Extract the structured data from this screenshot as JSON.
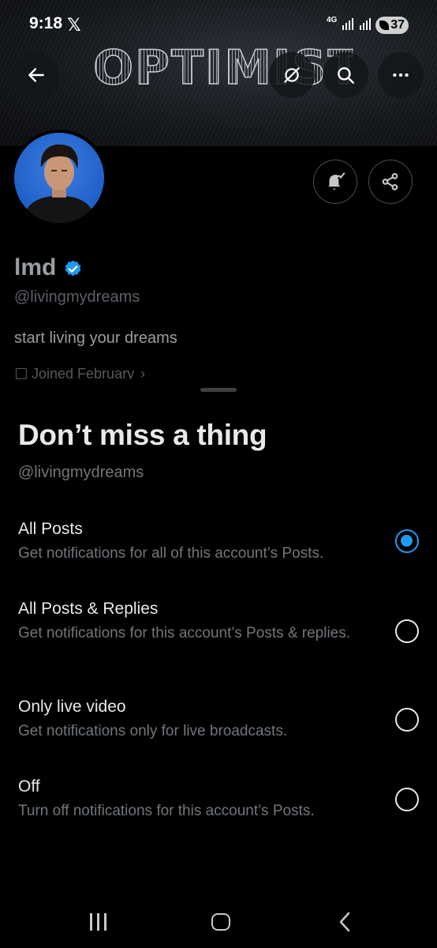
{
  "status_bar": {
    "time": "9:18",
    "app_icon": "x-logo-icon",
    "network": "4G",
    "battery": "37"
  },
  "header": {
    "banner_text": "OPTIMIST",
    "back_icon": "arrow-left-icon",
    "grok_icon": "grok-icon",
    "search_icon": "search-icon",
    "more_icon": "more-horizontal-icon"
  },
  "profile": {
    "name": "lmd",
    "handle": "@livingmydreams",
    "bio": "start living your dreams",
    "joined": "Joined February",
    "verified_color": "#1d9bf0",
    "notify_icon": "bell-check-icon",
    "share_icon": "share-icon"
  },
  "sheet": {
    "title": "Don’t miss a thing",
    "handle": "@livingmydreams",
    "options": [
      {
        "label": "All Posts",
        "description": "Get notifications for all of this account’s Posts.",
        "selected": true
      },
      {
        "label": "All Posts & Replies",
        "description": "Get notifications for this account’s Posts & replies.",
        "selected": false
      },
      {
        "label": "Only live video",
        "description": "Get notifications only for live broadcasts.",
        "selected": false
      },
      {
        "label": "Off",
        "description": "Turn off notifications for this account’s Posts.",
        "selected": false
      }
    ],
    "accent_color": "#1d9bf0"
  },
  "nav": {
    "recents_icon": "recent-apps-icon",
    "home_icon": "home-icon",
    "back_icon": "back-icon"
  }
}
